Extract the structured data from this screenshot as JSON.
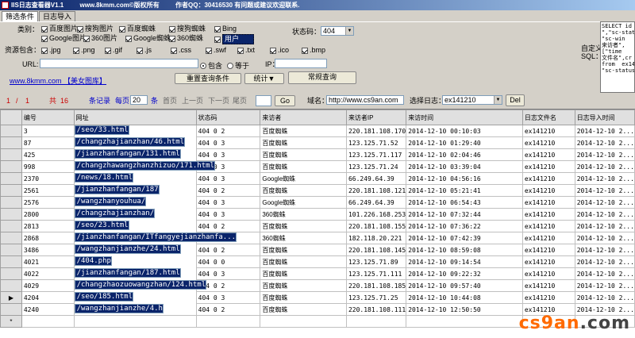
{
  "titlebar": {
    "app": "IIS日志查看器V1.1",
    "site": "www.8kmm.com©版权所有",
    "author": "作者QQ：30416530 有问题或建议欢迎联系."
  },
  "tabs": [
    "筛选条件",
    "日志导入"
  ],
  "filter": {
    "category_label": "类别：",
    "categories": [
      {
        "label": "百度图片",
        "checked": true
      },
      {
        "label": "搜狗图片",
        "checked": true
      },
      {
        "label": "百度蜘蛛",
        "checked": true
      },
      {
        "label": "搜狗蜘蛛",
        "checked": true
      },
      {
        "label": "Bing",
        "checked": true
      },
      {
        "label": "Google图片",
        "checked": true
      },
      {
        "label": "360图片",
        "checked": true
      },
      {
        "label": "Google蜘蛛",
        "checked": true
      },
      {
        "label": "360蜘蛛",
        "checked": true
      },
      {
        "label": "用户",
        "checked": true
      }
    ],
    "status_label": "状态码：",
    "status_value": "404",
    "resource_label": "资源包含：",
    "resources": [
      {
        "label": ".jpg",
        "checked": true
      },
      {
        "label": ".png",
        "checked": true
      },
      {
        "label": ".gif",
        "checked": true
      },
      {
        "label": ".js",
        "checked": true
      },
      {
        "label": ".css",
        "checked": true
      },
      {
        "label": ".swf",
        "checked": true
      },
      {
        "label": ".txt",
        "checked": true
      },
      {
        "label": ".ico",
        "checked": true
      },
      {
        "label": ".bmp",
        "checked": true
      }
    ],
    "url_label": "URL:",
    "url_value": "",
    "match_contains": "包含",
    "match_equals": "等于",
    "ip_label": "IP：",
    "ip_value": "",
    "site_link": "www.8kmm.com 【美女图库】",
    "reset_button": "重置查询条件",
    "stats_button": "统计▼",
    "query_button": "常规查询",
    "custom_sql_label": "自定义\nSQL：",
    "sql_text": "SELECT id\n\",\"sc-stat\n\"sc-win\n来访者\",\n[\"time\n文件名\",cr\nfrom  ex14\n\"sc-status"
  },
  "pager": {
    "current": "1",
    "sep": "/",
    "total_pages": "1",
    "total_label": "共",
    "total_count": "16",
    "records_label": "条记录",
    "per_page_label": "每页",
    "per_page": "20",
    "unit": "条",
    "first": "首页",
    "prev": "上一页",
    "next": "下一页",
    "last": "尾页",
    "go_value": "",
    "go_button": "Go",
    "domain_label": "域名：",
    "domain_value": "http://www.cs9an.com",
    "log_label": "选择日志：",
    "log_value": "ex141210",
    "del_button": "Del"
  },
  "table": {
    "headers": [
      "编号",
      "网址",
      "状态码",
      "来访者",
      "来访者IP",
      "来访时间",
      "日志文件名",
      "日志导入时间"
    ],
    "rows": [
      [
        "3",
        "/seo/33.html",
        "404 0 2",
        "百度蜘蛛",
        "220.181.108.170",
        "2014-12-10 00:10:03",
        "ex141210",
        "2014-12-10 2..."
      ],
      [
        "87",
        "/changzhajianzhan/46.html",
        "404 0 3",
        "百度蜘蛛",
        "123.125.71.52",
        "2014-12-10 01:29:40",
        "ex141210",
        "2014-12-10 2..."
      ],
      [
        "425",
        "/jianzhanfangan/131.html",
        "404 0 3",
        "百度蜘蛛",
        "123.125.71.117",
        "2014-12-10 02:04:46",
        "ex141210",
        "2014-12-10 2..."
      ],
      [
        "998",
        "/changzhawangzhanzhizuo/171.html",
        "404 0 3",
        "百度蜘蛛",
        "123.125.71.24",
        "2014-12-10 03:39:04",
        "ex141210",
        "2014-12-10 2..."
      ],
      [
        "2370",
        "/news/18.html",
        "404 0 3",
        "Google蜘蛛",
        "66.249.64.39",
        "2014-12-10 04:56:16",
        "ex141210",
        "2014-12-10 2..."
      ],
      [
        "2561",
        "/jianzhanfangan/187",
        "404 0 2",
        "百度蜘蛛",
        "220.181.108.121",
        "2014-12-10 05:21:41",
        "ex141210",
        "2014-12-10 2..."
      ],
      [
        "2576",
        "/wangzhanyouhua/",
        "404 0 3",
        "Google蜘蛛",
        "66.249.64.39",
        "2014-12-10 06:54:43",
        "ex141210",
        "2014-12-10 2..."
      ],
      [
        "2800",
        "/changzhajianzhan/",
        "404 0 3",
        "360蜘蛛",
        "101.226.168.253",
        "2014-12-10 07:32:44",
        "ex141210",
        "2014-12-10 2..."
      ],
      [
        "2813",
        "/seo/23.html",
        "404 0 2",
        "百度蜘蛛",
        "220.181.108.155",
        "2014-12-10 07:36:22",
        "ex141210",
        "2014-12-10 2..."
      ],
      [
        "2868",
        "/jianzhanfangan/ITfangyejianzhanfa...",
        "404 0 3",
        "360蜘蛛",
        "182.118.20.221",
        "2014-12-10 07:42:39",
        "ex141210",
        "2014-12-10 2..."
      ],
      [
        "3486",
        "/wangzhanjianzhe/24.html",
        "404 0 2",
        "百度蜘蛛",
        "220.181.108.145",
        "2014-12-10 08:59:08",
        "ex141210",
        "2014-12-10 2..."
      ],
      [
        "4021",
        "/404.php",
        "404 0 0",
        "百度蜘蛛",
        "123.125.71.89",
        "2014-12-10 09:14:54",
        "ex141210",
        "2014-12-10 2..."
      ],
      [
        "4022",
        "/jianzhanfangan/187.html",
        "404 0 3",
        "百度蜘蛛",
        "123.125.71.111",
        "2014-12-10 09:22:32",
        "ex141210",
        "2014-12-10 2..."
      ],
      [
        "4029",
        "/changzhaozuowangzhan/124.html",
        "404 0 2",
        "百度蜘蛛",
        "220.181.108.185",
        "2014-12-10 09:57:40",
        "ex141210",
        "2014-12-10 2..."
      ],
      [
        "4204",
        "/seo/185.html",
        "404 0 3",
        "百度蜘蛛",
        "123.125.71.25",
        "2014-12-10 10:44:08",
        "ex141210",
        "2014-12-10 2..."
      ],
      [
        "4240",
        "/wangzhanjianzhe/4.h",
        "404 0 2",
        "百度蜘蛛",
        "220.181.108.111",
        "2014-12-10 12:50:50",
        "ex141210",
        "2014-12-10 2..."
      ]
    ],
    "new_row_marker": "*",
    "current_row_marker": "▶"
  },
  "watermark": {
    "a": "cs9an",
    "b": ".com"
  }
}
